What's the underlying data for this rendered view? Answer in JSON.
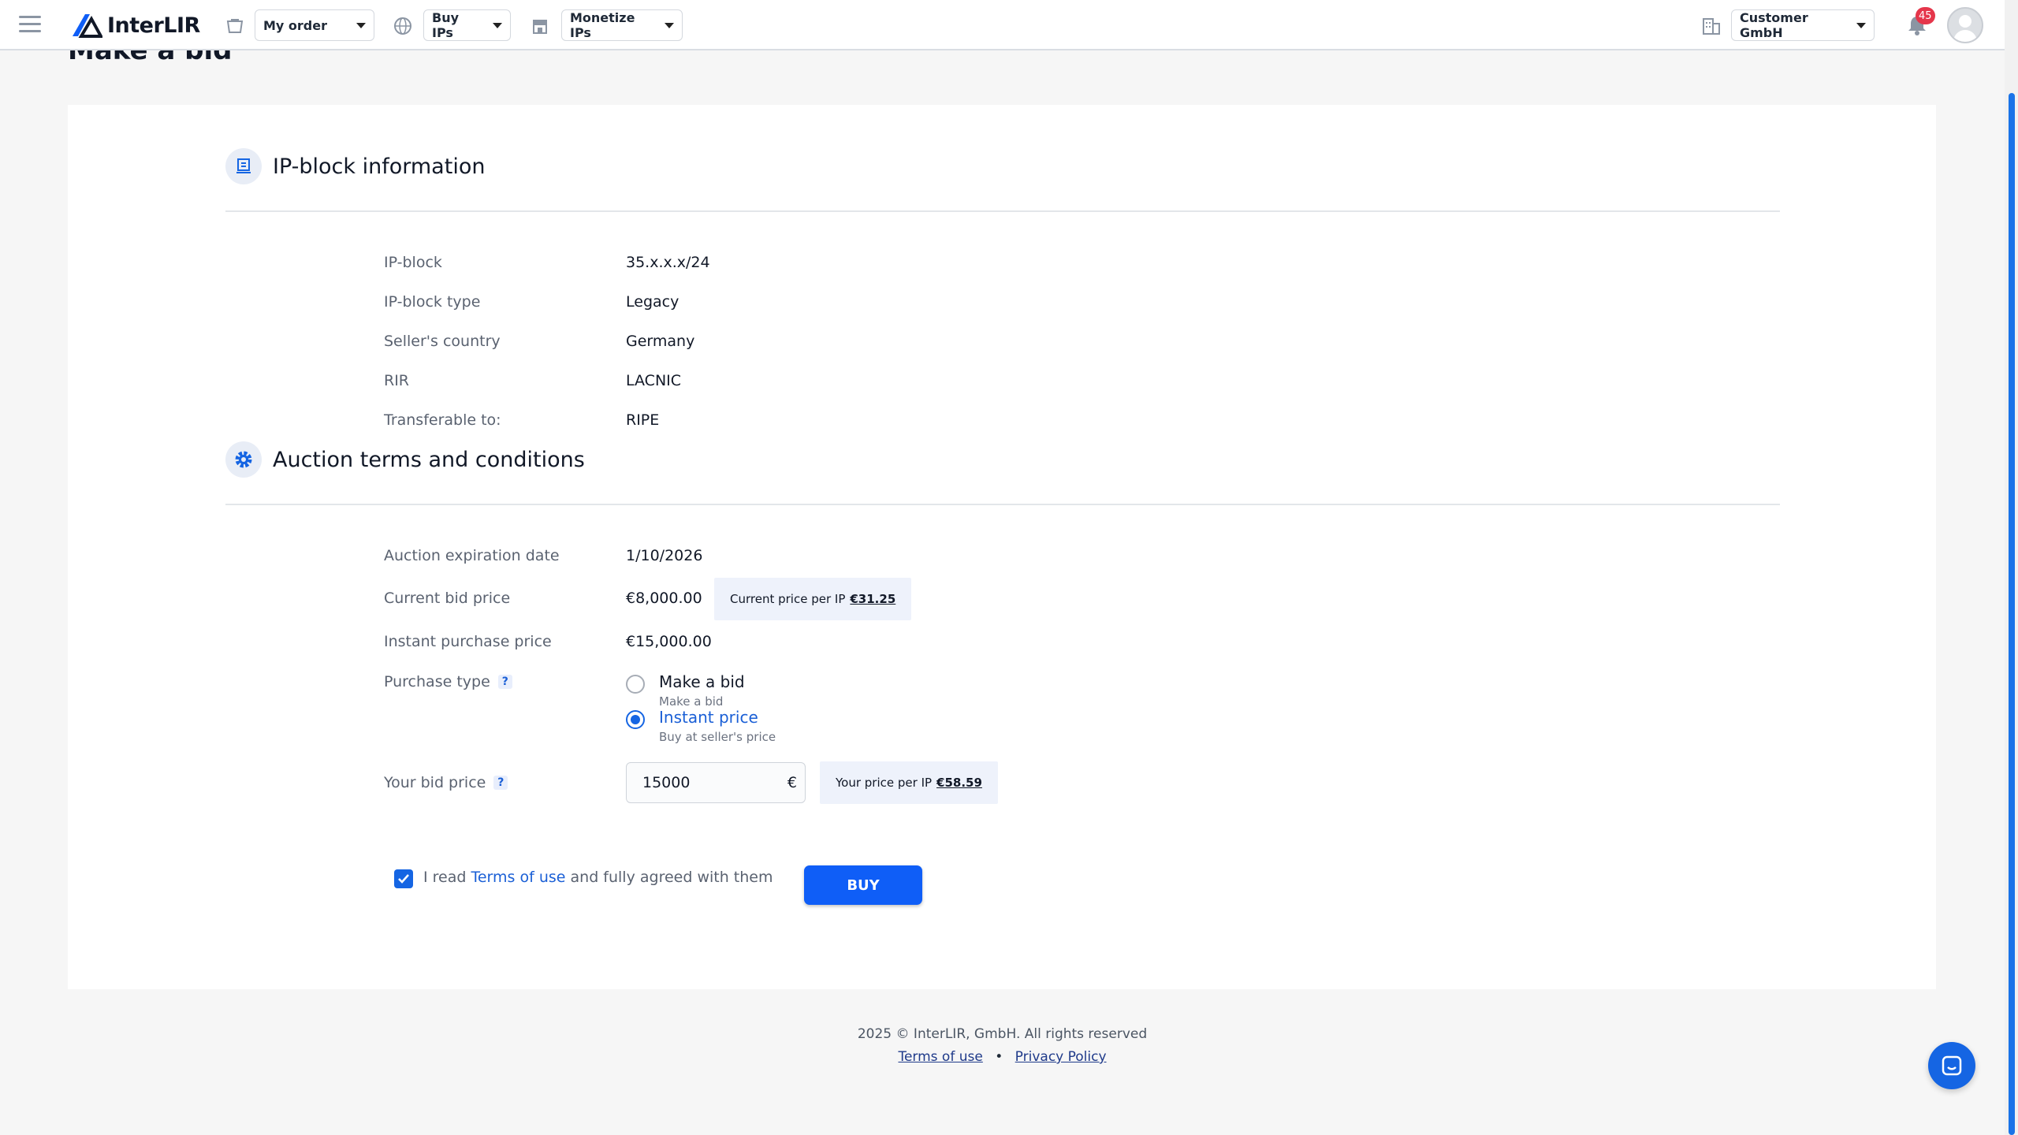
{
  "header": {
    "logo_text": "InterLIR",
    "my_order_label": "My order",
    "buy_ips_label": "Buy IPs",
    "monetize_ips_label": "Monetize IPs",
    "company_label": "Customer GmbH",
    "notification_count": "45"
  },
  "page": {
    "title": "Make a bid"
  },
  "ip_block": {
    "section_title": "IP-block information",
    "rows": [
      {
        "label": "IP-block",
        "value": "35.x.x.x/24"
      },
      {
        "label": "IP-block type",
        "value": "Legacy"
      },
      {
        "label": "Seller's country",
        "value": "Germany"
      },
      {
        "label": "RIR",
        "value": "LACNIC"
      },
      {
        "label": "Transferable to:",
        "value": "RIPE"
      }
    ]
  },
  "auction": {
    "section_title": "Auction terms and conditions",
    "expiration_label": "Auction expiration date",
    "expiration_value": "1/10/2026",
    "current_bid_label": "Current bid price",
    "current_bid_value": "€8,000.00",
    "current_per_ip_label": "Current price per IP",
    "current_per_ip_value": "€31.25",
    "instant_label": "Instant purchase price",
    "instant_value": "€15,000.00",
    "purchase_type_label": "Purchase type",
    "options": [
      {
        "label": "Make a bid",
        "sub": "Make a bid",
        "selected": false
      },
      {
        "label": "Instant price",
        "sub": "Buy at seller's price",
        "selected": true
      }
    ],
    "your_bid_label": "Your bid price",
    "your_bid_value": "15000",
    "currency_symbol": "€",
    "your_per_ip_label": "Your price per IP",
    "your_per_ip_value": "€58.59",
    "help_glyph": "?"
  },
  "agreement": {
    "prefix": "I read",
    "link": "Terms of use",
    "suffix": "and fully agreed with them",
    "checked": true
  },
  "buy_button_label": "BUY",
  "footer": {
    "copyright": "2025 © InterLIR, GmbH. All rights reserved",
    "terms_link": "Terms of use",
    "separator": "•",
    "privacy_link": "Privacy Policy"
  },
  "colors": {
    "accent": "#0f5ef7",
    "badge": "#e5364b"
  }
}
